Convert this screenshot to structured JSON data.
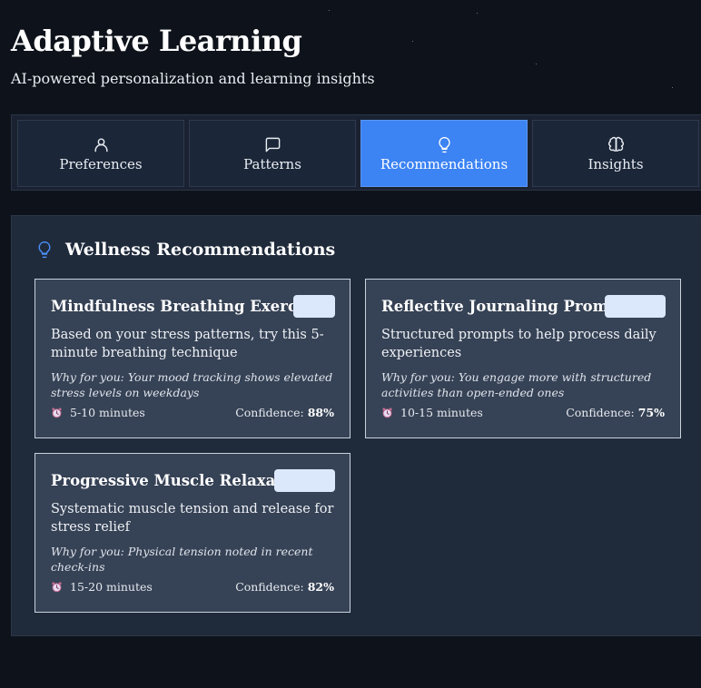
{
  "header": {
    "title": "Adaptive Learning",
    "subtitle": "AI-powered personalization and learning insights"
  },
  "tabs": [
    {
      "label": "Preferences",
      "icon": "user-icon",
      "active": false
    },
    {
      "label": "Patterns",
      "icon": "message-square-icon",
      "active": false
    },
    {
      "label": "Recommendations",
      "icon": "lightbulb-icon",
      "active": true
    },
    {
      "label": "Insights",
      "icon": "brain-icon",
      "active": false
    }
  ],
  "section": {
    "title": "Wellness Recommendations",
    "icon": "lightbulb-icon"
  },
  "cards": [
    {
      "title": "Mindfulness Breathing Exercise",
      "description": "Based on your stress patterns, try this 5-minute breathing technique",
      "why": "Why for you: Your mood tracking shows elevated stress levels on weekdays",
      "duration": "5-10 minutes",
      "confidence_label": "Confidence:",
      "confidence_value": "88%"
    },
    {
      "title": "Reflective Journaling Prompts",
      "description": "Structured prompts to help process daily experiences",
      "why": "Why for you: You engage more with structured activities than open-ended ones",
      "duration": "10-15 minutes",
      "confidence_label": "Confidence:",
      "confidence_value": "75%"
    },
    {
      "title": "Progressive Muscle Relaxation",
      "description": "Systematic muscle tension and release for stress relief",
      "why": "Why for you: Physical tension noted in recent check-ins",
      "duration": "15-20 minutes",
      "confidence_label": "Confidence:",
      "confidence_value": "82%"
    }
  ],
  "colors": {
    "background": "#0e131b",
    "panel": "#1f2a3b",
    "card": "#364255",
    "accent": "#3c83f3",
    "badge": "#dbe7fb"
  }
}
